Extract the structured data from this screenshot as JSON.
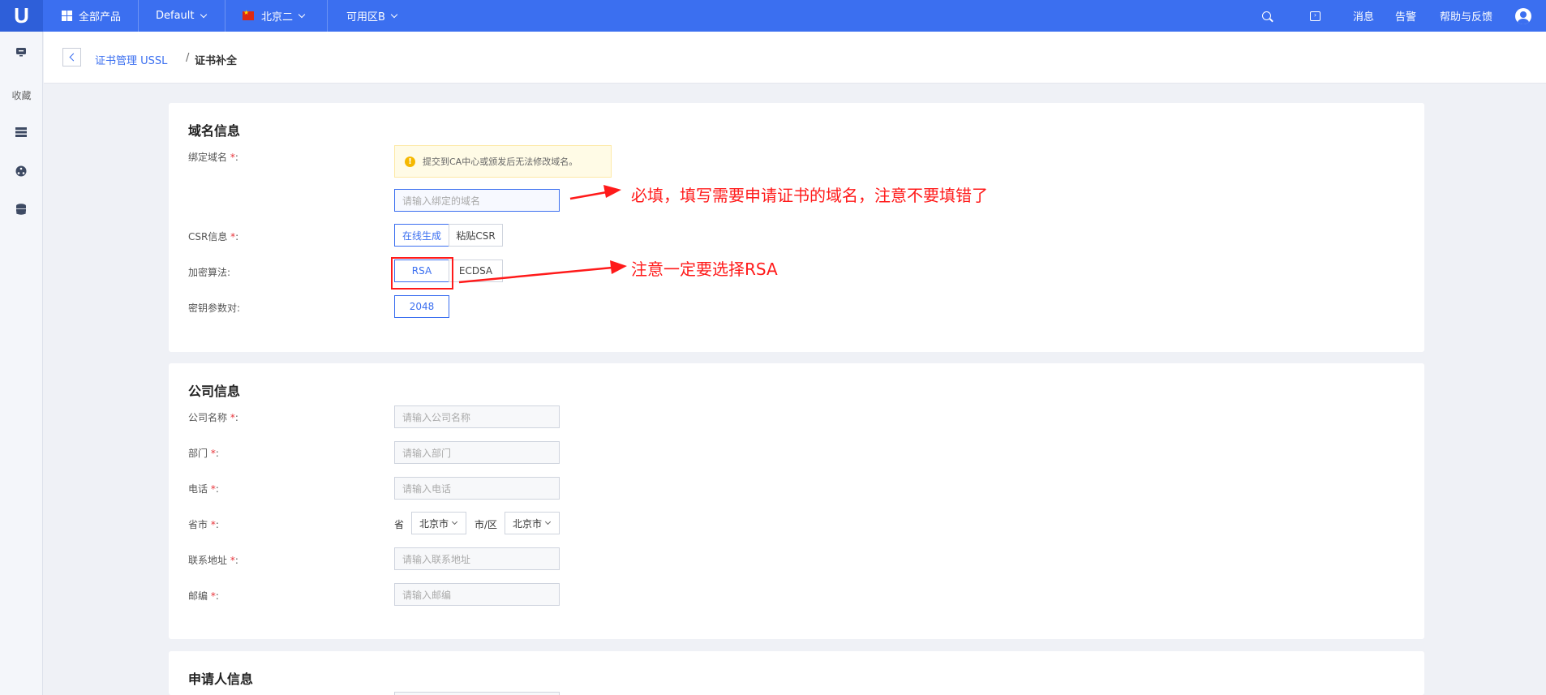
{
  "topbar": {
    "logo": "U",
    "all_products": "全部产品",
    "project": "Default",
    "region": "北京二",
    "zone": "可用区B",
    "messages": "消息",
    "alerts": "告警",
    "help": "帮助与反馈"
  },
  "sidebar": {
    "favorites": "收藏"
  },
  "breadcrumb": {
    "parent": "证书管理 USSL",
    "separator": "/",
    "current": "证书补全"
  },
  "domain_section": {
    "title": "域名信息",
    "bind_domain_label": "绑定域名",
    "notice": "提交到CA中心或颁发后无法修改域名。",
    "domain_placeholder": "请输入绑定的域名",
    "csr_label": "CSR信息",
    "csr_options": [
      "在线生成",
      "粘贴CSR"
    ],
    "csr_selected": "在线生成",
    "algo_label": "加密算法:",
    "algo_options": [
      "RSA",
      "ECDSA"
    ],
    "algo_selected": "RSA",
    "key_label": "密钥参数对:",
    "key_value": "2048"
  },
  "company_section": {
    "title": "公司信息",
    "name_label": "公司名称",
    "name_placeholder": "请输入公司名称",
    "dept_label": "部门",
    "dept_placeholder": "请输入部门",
    "phone_label": "电话",
    "phone_placeholder": "请输入电话",
    "province_label": "省市",
    "province_prefix": "省",
    "province_value": "北京市",
    "city_prefix": "市/区",
    "city_value": "北京市",
    "address_label": "联系地址",
    "address_placeholder": "请输入联系地址",
    "zip_label": "邮编",
    "zip_placeholder": "请输入邮编"
  },
  "applicant_section": {
    "title": "申请人信息"
  },
  "required_mark": "*",
  "colon": ":",
  "annotations": {
    "domain_note": "必填，填写需要申请证书的域名，注意不要填错了",
    "rsa_note": "注意一定要选择RSA",
    "color": "#ff1a1a"
  },
  "colors": {
    "topbar": "#3b6ff0",
    "accent": "#3b6ff0",
    "required": "#e8343b"
  }
}
